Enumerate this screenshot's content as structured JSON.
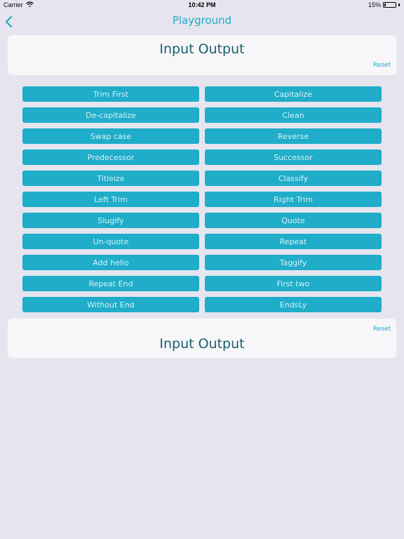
{
  "status": {
    "carrier": "Carrier",
    "time": "10:42 PM",
    "battery": "15%",
    "battery_level": 0.15
  },
  "nav": {
    "title": "Playground"
  },
  "input_card": {
    "label": "Input Output",
    "reset_label": "Reset"
  },
  "output_card": {
    "label": "Input Output",
    "reset_label": "Reset"
  },
  "operations": [
    "Trim First",
    "Capitalize",
    "De-capitalize",
    "Clean",
    "Swap case",
    "Reverse",
    "Predecessor",
    "Successor",
    "Titleize",
    "Classify",
    "Left Trim",
    "Right Trim",
    "Slugify",
    "Quote",
    "Un-quote",
    "Repeat",
    "Add hello",
    "Taggify",
    "Repeat End",
    "First two",
    "Without End",
    "EndsLy"
  ],
  "colors": {
    "accent": "#1fadc9",
    "background": "#e6e5ef",
    "card": "#f7f7f9"
  }
}
